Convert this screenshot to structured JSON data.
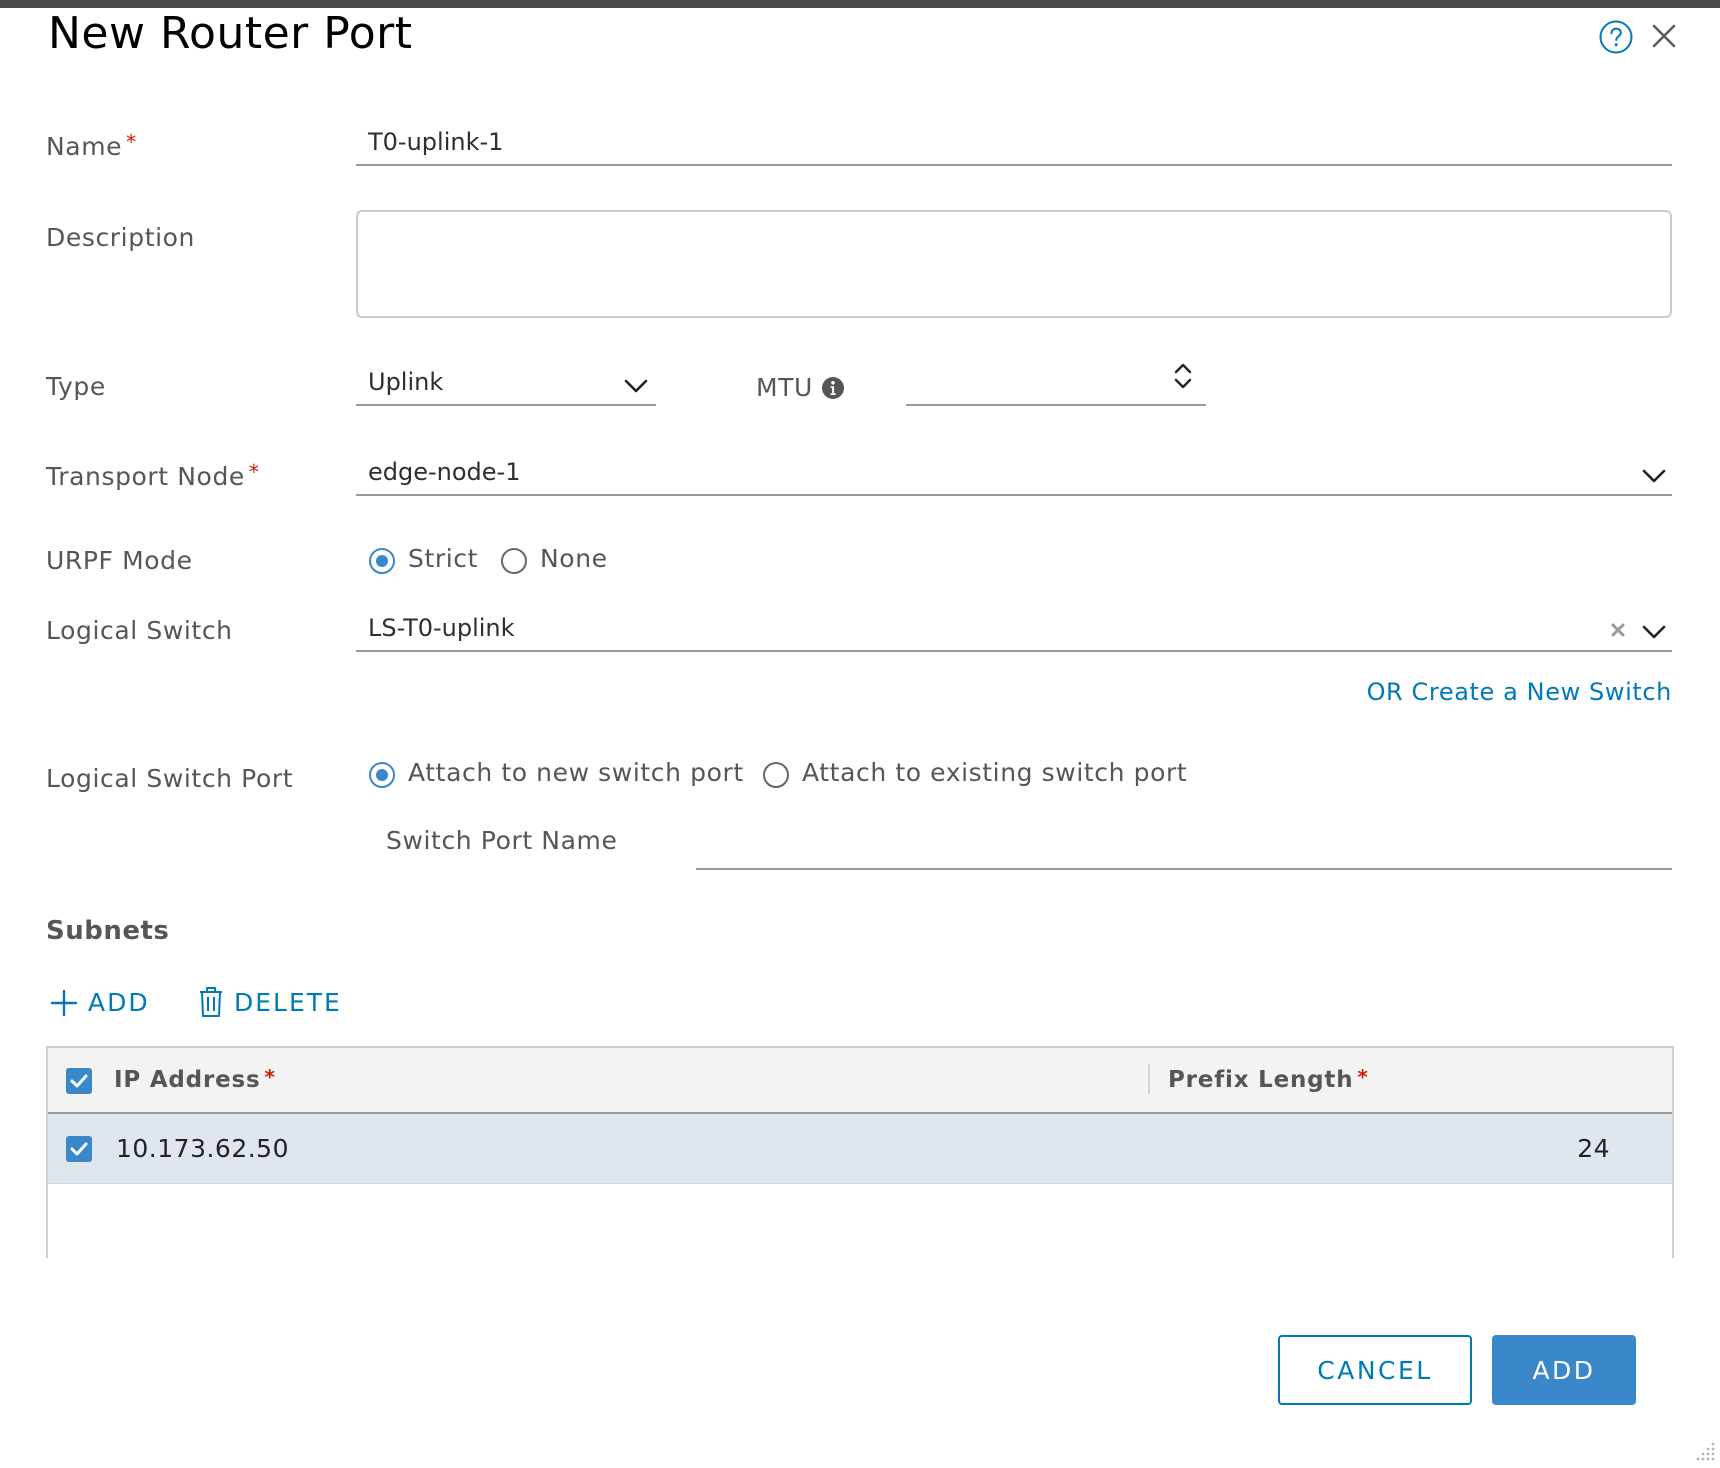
{
  "dialog": {
    "title": "New Router Port",
    "help_icon": "help-circle-icon",
    "close_icon": "close-icon"
  },
  "form": {
    "name": {
      "label": "Name",
      "required_mark": "*",
      "value": "T0-uplink-1"
    },
    "description": {
      "label": "Description",
      "value": ""
    },
    "type": {
      "label": "Type",
      "value": "Uplink"
    },
    "mtu": {
      "label": "MTU",
      "info_icon": "info-icon",
      "value": ""
    },
    "transport_node": {
      "label": "Transport Node",
      "required_mark": "*",
      "value": "edge-node-1"
    },
    "urpf_mode": {
      "label": "URPF Mode",
      "options": [
        {
          "label": "Strict",
          "selected": true
        },
        {
          "label": "None",
          "selected": false
        }
      ]
    },
    "logical_switch": {
      "label": "Logical Switch",
      "value": "LS-T0-uplink",
      "create_link": "OR Create a New Switch"
    },
    "logical_switch_port": {
      "label": "Logical Switch Port",
      "options": [
        {
          "label": "Attach to new switch port",
          "selected": true
        },
        {
          "label": "Attach to existing switch port",
          "selected": false
        }
      ],
      "switch_port_name": {
        "label": "Switch Port Name",
        "value": ""
      }
    }
  },
  "subnets": {
    "title": "Subnets",
    "add_label": "ADD",
    "delete_label": "DELETE",
    "columns": [
      {
        "label": "IP Address",
        "required_mark": "*"
      },
      {
        "label": "Prefix Length",
        "required_mark": "*"
      }
    ],
    "rows": [
      {
        "ip_address": "10.173.62.50",
        "prefix_length": "24",
        "checked": true
      }
    ]
  },
  "footer": {
    "cancel_label": "CANCEL",
    "add_label": "ADD"
  },
  "colors": {
    "accent": "#0079b8",
    "primary_button": "#3a87c9",
    "required": "#c92100",
    "selected_row": "#dfe6ee"
  }
}
